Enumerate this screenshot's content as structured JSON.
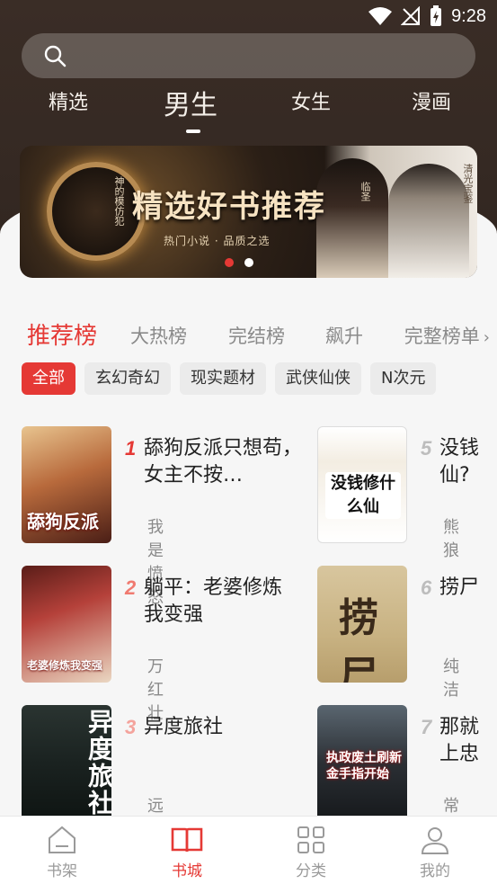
{
  "status_bar": {
    "time": "9:28"
  },
  "search": {
    "placeholder": ""
  },
  "top_tabs": [
    {
      "label": "精选"
    },
    {
      "label": "男生"
    },
    {
      "label": "女生"
    },
    {
      "label": "漫画"
    }
  ],
  "banner": {
    "title": "精选好书推荐",
    "subtitle": "热门小说 · 品质之选",
    "side_left": "神的模仿犯",
    "side_mid": "临圣",
    "side_right": "清光宝鉴",
    "slides": 2,
    "active_slide": 1
  },
  "rank_tabs": [
    {
      "label": "推荐榜"
    },
    {
      "label": "大热榜"
    },
    {
      "label": "完结榜"
    },
    {
      "label": "飙升"
    }
  ],
  "rank_more": "完整榜单",
  "chips": [
    "全部",
    "玄幻奇幻",
    "现实题材",
    "武侠仙侠",
    "N次元"
  ],
  "books": [
    {
      "rank": "1",
      "title": "舔狗反派只想苟，女主不按…",
      "author": "我是愤怒",
      "cover_text": "舔狗反派"
    },
    {
      "rank": "2",
      "title": "躺平：老婆修炼我变强",
      "author": "万红壮",
      "cover_text": "老婆修炼我变强"
    },
    {
      "rank": "3",
      "title": "异度旅社",
      "author": "远瞳",
      "cover_text": "异度旅社"
    },
    {
      "rank": "5",
      "title": "没钱仙?",
      "author": "熊狼",
      "cover_text": "没钱修什么仙"
    },
    {
      "rank": "6",
      "title": "捞尸",
      "author": "纯洁",
      "cover_text": "捞尸"
    },
    {
      "rank": "7",
      "title": "那就上忠",
      "author": "常世",
      "cover_text": "执政废土刷新金手指开始"
    }
  ],
  "bottom_nav": [
    {
      "label": "书架",
      "icon": "bookshelf-icon"
    },
    {
      "label": "书城",
      "icon": "open-book-icon"
    },
    {
      "label": "分类",
      "icon": "grid-icon"
    },
    {
      "label": "我的",
      "icon": "user-icon"
    }
  ],
  "colors": {
    "accent": "#e53935",
    "header_bg": "#3a2d26"
  }
}
